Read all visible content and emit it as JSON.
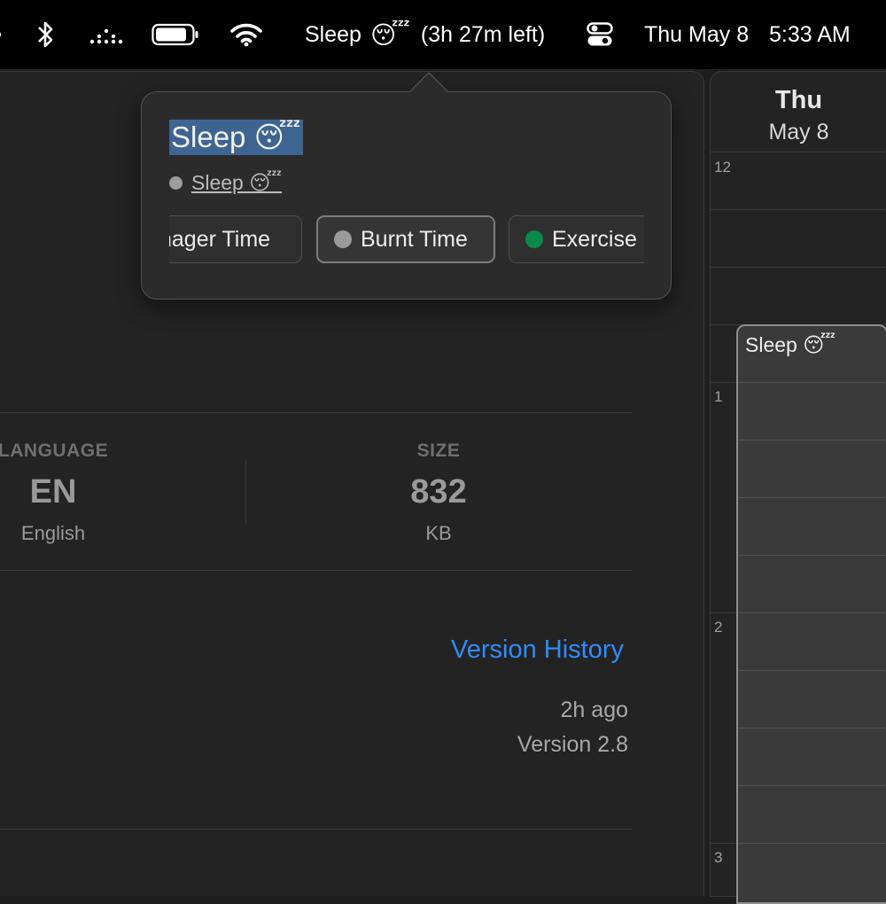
{
  "menubar": {
    "focus_label": "Sleep",
    "focus_emoji": "😴",
    "focus_remaining": "(3h 27m left)",
    "date": "Thu May 8",
    "time": "5:33 AM"
  },
  "app": {
    "language": {
      "label": "LANGUAGE",
      "value": "EN",
      "sub": "English"
    },
    "size": {
      "label": "SIZE",
      "value": "832",
      "sub": "KB"
    },
    "version_history_link": "Version History",
    "updated": "2h ago",
    "version": "Version 2.8"
  },
  "popover": {
    "title": "Sleep 😴",
    "calendar_link": "Sleep 😴",
    "calendars": [
      {
        "label": "nager Time",
        "color": ""
      },
      {
        "label": "Burnt Time",
        "color": "#9a9a9a"
      },
      {
        "label": "Exercise",
        "color": "#0a8a4a"
      }
    ]
  },
  "calendar": {
    "day": "Thu",
    "date": "May 8",
    "hours": [
      "12",
      "1",
      "2",
      "3"
    ],
    "event_title": "Sleep 😴"
  }
}
